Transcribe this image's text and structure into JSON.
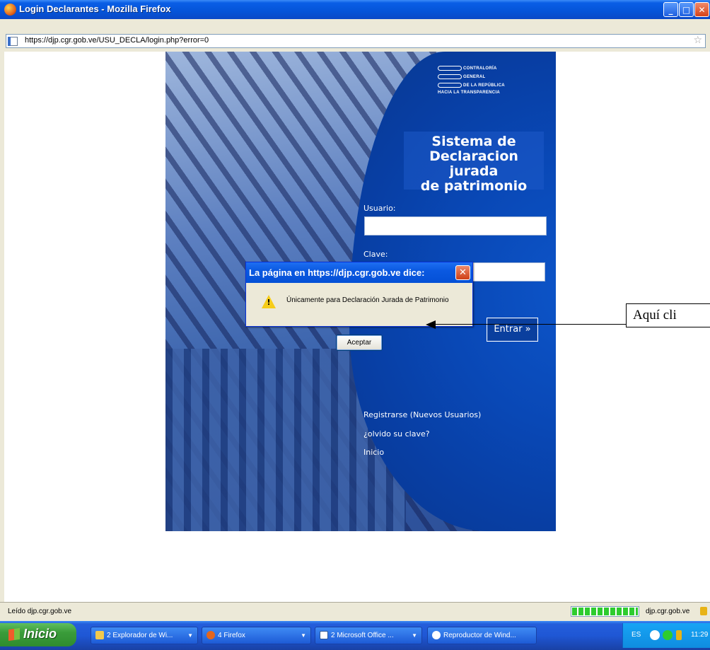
{
  "window": {
    "title": "Login Declarantes - Mozilla Firefox",
    "buttons": {
      "minimize": "_",
      "maximize": "□",
      "close": "✕"
    }
  },
  "addressbar": {
    "url": "https://djp.cgr.gob.ve/USU_DECLA/login.php?error=0"
  },
  "page": {
    "logo": {
      "line1": "CONTRALORÍA",
      "line2": "GENERAL",
      "line3": "DE LA REPÚBLICA",
      "line4": "HACIA LA TRANSPARENCIA"
    },
    "system_title": {
      "line1": "Sistema de",
      "line2": "Declaracion jurada",
      "line3": "de patrimonio"
    },
    "form": {
      "usuario_label": "Usuario:",
      "usuario_value": "",
      "clave_label": "Clave:",
      "clave_value": "",
      "entrar_label": "Entrar »"
    },
    "links": {
      "register": "Registrarse (Nuevos Usuarios)",
      "forgot": "¿olvido su clave?",
      "home": "Inicio"
    }
  },
  "dialog": {
    "title": "La página en https://djp.cgr.gob.ve dice:",
    "message": "Únicamente para Declaración Jurada de Patrimonio",
    "ok_label": "Aceptar",
    "close_glyph": "✕",
    "warning_glyph": "!"
  },
  "annotation": {
    "text": "Aquí cli"
  },
  "statusbar": {
    "status_text": "Leído djp.cgr.gob.ve",
    "domain": "djp.cgr.gob.ve",
    "progress": 1.0
  },
  "taskbar": {
    "start_label": "Inicio",
    "buttons": [
      {
        "label": "2 Explorador de Wi...",
        "icon": "folder-icon"
      },
      {
        "label": "4 Firefox",
        "icon": "firefox-icon"
      },
      {
        "label": "2 Microsoft Office ...",
        "icon": "word-icon"
      },
      {
        "label": "Reproductor de Wind...",
        "icon": "media-player-icon"
      }
    ],
    "tray": {
      "language": "ES",
      "clock": "11:29"
    }
  },
  "colors": {
    "xp_blue": "#0554d8",
    "panel_blue": "#0948b6",
    "start_green": "#3a9c3a",
    "warning_yellow": "#f6cc18"
  }
}
